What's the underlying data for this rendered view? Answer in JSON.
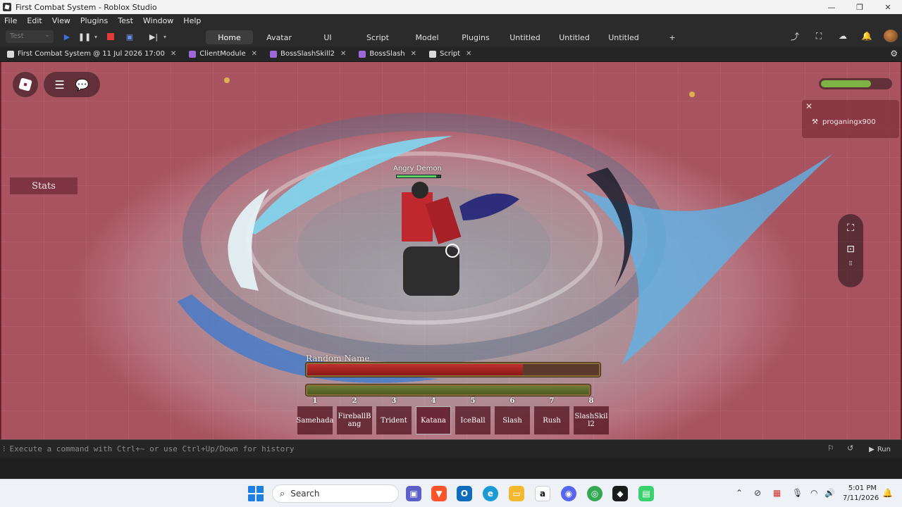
{
  "window": {
    "title": "First Combat System - Roblox Studio",
    "minimize": "—",
    "restore": "❐",
    "close": "✕"
  },
  "menu": [
    "File",
    "Edit",
    "View",
    "Plugins",
    "Test",
    "Window",
    "Help"
  ],
  "ribbon": {
    "mode": "Test",
    "tabs": [
      "Home",
      "Avatar",
      "UI",
      "Script",
      "Model",
      "Plugins",
      "Untitled",
      "Untitled",
      "Untitled",
      "+"
    ],
    "active_tab": "Home"
  },
  "doc_tabs": [
    {
      "label": "First Combat System @ 11 Jul 2026 17:00",
      "icon_color": "#d9d9d9"
    },
    {
      "label": "ClientModule",
      "icon_color": "#9c6ad8"
    },
    {
      "label": "BossSlashSkill2",
      "icon_color": "#9c6ad8"
    },
    {
      "label": "BossSlash",
      "icon_color": "#9c6ad8"
    },
    {
      "label": "Script",
      "icon_color": "#d9d9d9"
    }
  ],
  "game": {
    "player_health_fraction": 0.72,
    "notification_user": "proganingx900",
    "stats_label": "Stats",
    "boss": {
      "name": "Angry Demon",
      "health_fraction": 0.9
    },
    "player": {
      "name": "Random Name",
      "health_fraction": 0.74,
      "stamina_fraction": 1.0
    },
    "hotbar": [
      {
        "key": "1",
        "label": "Samehada"
      },
      {
        "key": "2",
        "label": "FireballBang"
      },
      {
        "key": "3",
        "label": "Trident"
      },
      {
        "key": "4",
        "label": "Katana"
      },
      {
        "key": "5",
        "label": "IceBall"
      },
      {
        "key": "6",
        "label": "Slash"
      },
      {
        "key": "7",
        "label": "Rush"
      },
      {
        "key": "8",
        "label": "SlashSkill2"
      }
    ],
    "selected_slot": "4"
  },
  "command_bar": {
    "placeholder": "Execute a command with Ctrl+~ or use Ctrl+Up/Down for history",
    "run_label": "Run"
  },
  "taskbar": {
    "search_placeholder": "Search",
    "time": "5:01 PM",
    "date": "7/11/2026"
  },
  "colors": {
    "accent": "#3d3d3d",
    "health": "#c03030",
    "stamina": "#6f7c36",
    "hud_health": "#7cb342"
  }
}
